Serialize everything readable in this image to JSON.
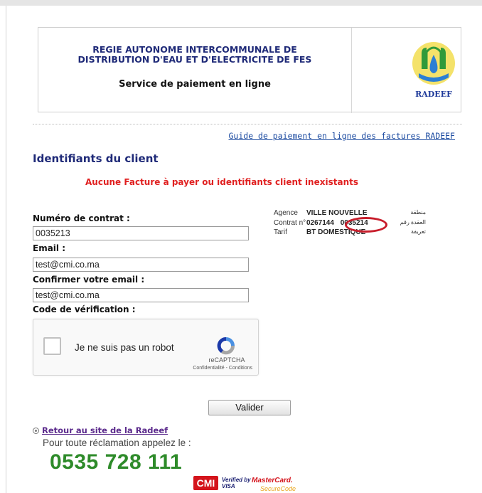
{
  "header": {
    "org_line1": "REGIE AUTONOME INTERCOMMUNALE DE",
    "org_line2": "DISTRIBUTION D'EAU ET D'ELECTRICITE DE FES",
    "service": "Service de paiement en ligne",
    "logo_text": "RADEEF"
  },
  "guide_link": "Guide de paiement en ligne des factures RADEEF",
  "section_title": "Identifiants du client",
  "error_message": "Aucune Facture à payer ou identifiants client inexistants",
  "form": {
    "contract_label": "Numéro de contrat :",
    "contract_value": "0035213",
    "email_label": "Email :",
    "email_value": "test@cmi.co.ma",
    "confirm_label": "Confirmer votre email :",
    "confirm_value": "test@cmi.co.ma",
    "code_label": "Code de vérification :",
    "submit_label": "Valider"
  },
  "recaptcha": {
    "label": "Je ne suis pas un robot",
    "brand": "reCAPTCHA",
    "links": "Confidentialité - Conditions"
  },
  "contract_image": {
    "agence_label": "Agence",
    "agence_value": "VILLE NOUVELLE",
    "agence_ar": "منطقة",
    "contrat_label": "Contrat n°",
    "contrat_prefix": "0267144",
    "contrat_number": "0035214",
    "contrat_ar": "العقدة رقم",
    "tarif_label": "Tarif",
    "tarif_value": "BT DOMESTIQUE",
    "tarif_ar": "تعريفة"
  },
  "footer": {
    "back_link": "Retour au site de la Radeef",
    "claim_text": "Pour toute réclamation appelez le :",
    "phone": "0535 728 111",
    "cmi": "CMI",
    "visa_line1": "Verified by",
    "visa_line2": "VISA",
    "mc_line1": "MasterCard.",
    "mc_line2": "SecureCode"
  },
  "colors": {
    "title_blue": "#1f2a78",
    "error_red": "#e02020",
    "phone_green": "#2e8b2a",
    "link_blue": "#1b4aa0"
  }
}
